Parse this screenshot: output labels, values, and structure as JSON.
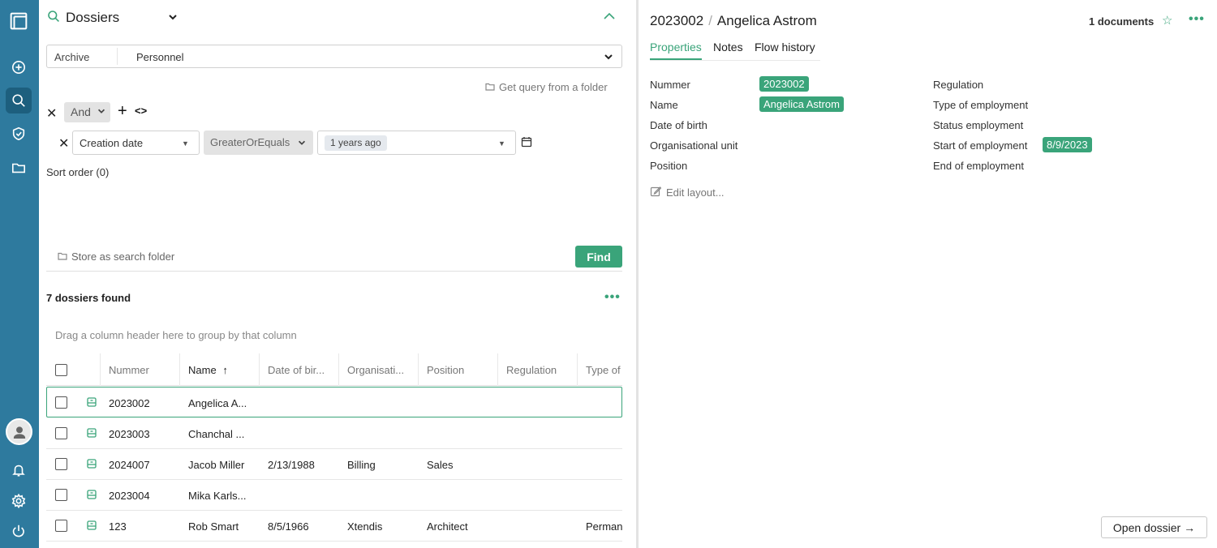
{
  "search": {
    "title": "Dossiers",
    "archive_label": "Archive",
    "archive_value": "Personnel",
    "get_query_label": "Get query from a folder",
    "logic_operator": "And",
    "condition": {
      "field": "Creation date",
      "operator": "GreaterOrEquals",
      "value": "1 years ago"
    },
    "sort_order_label": "Sort order (0)",
    "store_folder_label": "Store as search folder",
    "find_label": "Find"
  },
  "results": {
    "found_label": "7 dossiers found",
    "group_hint": "Drag a column header here to group by that column",
    "columns": [
      "Nummer",
      "Name",
      "Date of bir...",
      "Organisati...",
      "Position",
      "Regulation",
      "Type of"
    ],
    "rows": [
      {
        "nummer": "2023002",
        "name": "Angelica A...",
        "dob": "",
        "org": "",
        "position": "",
        "regulation": "",
        "type": ""
      },
      {
        "nummer": "2023003",
        "name": "Chanchal ...",
        "dob": "",
        "org": "",
        "position": "",
        "regulation": "",
        "type": ""
      },
      {
        "nummer": "2024007",
        "name": "Jacob Miller",
        "dob": "2/13/1988",
        "org": "Billing",
        "position": "Sales",
        "regulation": "",
        "type": ""
      },
      {
        "nummer": "2023004",
        "name": "Mika Karls...",
        "dob": "",
        "org": "",
        "position": "",
        "regulation": "",
        "type": ""
      },
      {
        "nummer": "123",
        "name": "Rob Smart",
        "dob": "8/5/1966",
        "org": "Xtendis",
        "position": "Architect",
        "regulation": "",
        "type": "Perman"
      }
    ]
  },
  "detail": {
    "number": "2023002",
    "name": "Angelica Astrom",
    "documents_label": "1 documents",
    "tabs": [
      "Properties",
      "Notes",
      "Flow history"
    ],
    "left_props": [
      {
        "label": "Nummer",
        "value": "2023002"
      },
      {
        "label": "Name",
        "value": "Angelica Astrom"
      },
      {
        "label": "Date of birth",
        "value": ""
      },
      {
        "label": "Organisational unit",
        "value": ""
      },
      {
        "label": "Position",
        "value": ""
      }
    ],
    "right_props": [
      {
        "label": "Regulation",
        "value": ""
      },
      {
        "label": "Type of employment",
        "value": ""
      },
      {
        "label": "Status employment",
        "value": ""
      },
      {
        "label": "Start of employment",
        "value": "8/9/2023"
      },
      {
        "label": "End of employment",
        "value": ""
      }
    ],
    "edit_layout_label": "Edit layout...",
    "open_dossier_label": "Open dossier →"
  },
  "icons": {
    "sidebar": [
      "app-logo-icon",
      "add-icon",
      "search-icon",
      "shield-icon",
      "folder-icon",
      "user-avatar-icon",
      "bell-icon",
      "gear-icon",
      "power-icon"
    ],
    "dossier_row": "dossier-icon"
  },
  "colors": {
    "sidebar": "#2e7a9e",
    "sidebar_active": "#1d5f7e",
    "accent": "#3aa47a"
  }
}
